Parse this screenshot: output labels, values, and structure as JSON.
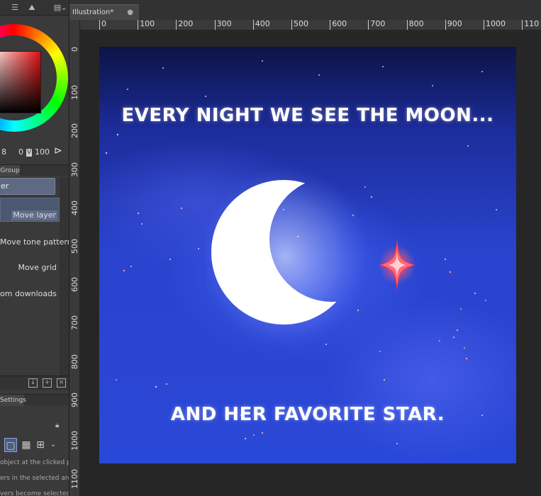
{
  "document": {
    "tab_title": "Illustration*",
    "tab_dot": "●"
  },
  "color": {
    "readout_a": "8",
    "readout_b": "0",
    "readout_v": "V",
    "readout_c": "100"
  },
  "layer_panel": {
    "tab_label": "Group",
    "select_value": "er"
  },
  "tools": {
    "move_layer": "Move layer",
    "move_tone": "Move tone pattern",
    "move_grid": "Move grid",
    "downloads": "om downloads"
  },
  "settings": {
    "tab_label": "Settings",
    "line1": "object at the clicked p",
    "line2": "ers in the selected area",
    "line3": "vers become selected"
  },
  "ruler": {
    "top": [
      "0",
      "100",
      "200",
      "300",
      "400",
      "500",
      "600",
      "700",
      "800",
      "900",
      "1000",
      "110"
    ],
    "left": [
      "0",
      "100",
      "200",
      "300",
      "400",
      "500",
      "600",
      "700",
      "800",
      "900",
      "1000",
      "1100"
    ]
  },
  "illustration": {
    "caption_top": "EVERY NIGHT WE SEE THE MOON...",
    "caption_bottom": "AND HER FAVORITE STAR."
  },
  "colors": {
    "sky_dark": "#0d1446",
    "sky_mid": "#2a44d0",
    "moon": "#ffffff",
    "star": "#ff5a6a"
  }
}
